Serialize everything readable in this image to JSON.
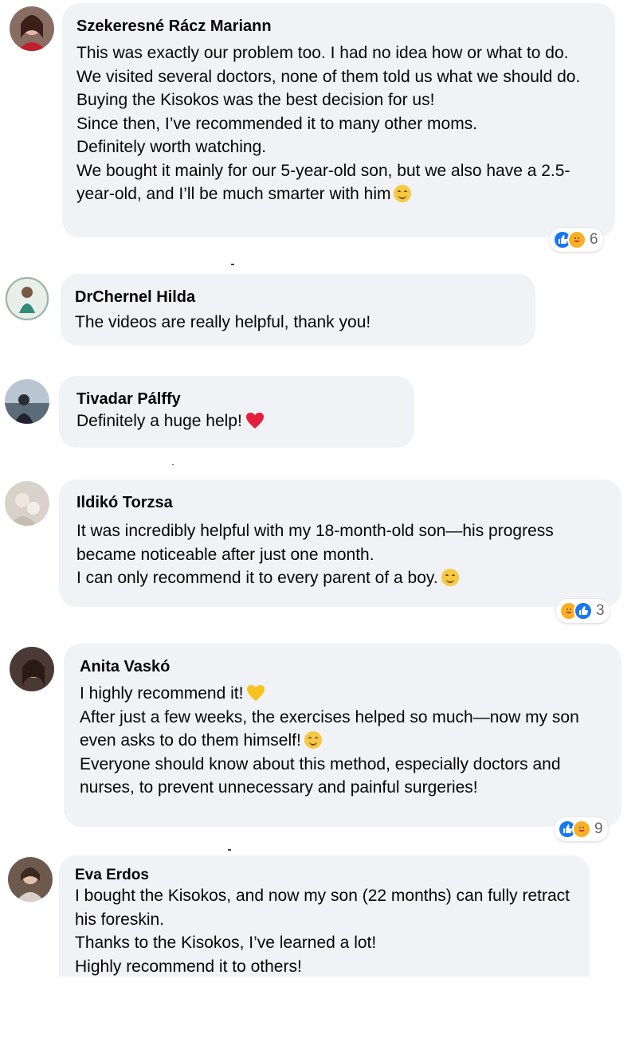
{
  "comments": [
    {
      "name": "Szekeresné Rácz Mariann",
      "lines": [
        "This was exactly our problem too. I had no idea how or what to do.",
        "We visited several doctors, none of them told us what we should do.",
        "Buying the Kisokos was the best decision for us!",
        "Since then, I’ve recommended it to many other moms.",
        "Definitely worth watching.",
        "We bought it mainly for our 5-year-old son, but we also have a 2.5-",
        "year-old, and I’ll be much smarter with him"
      ],
      "reactions": [
        "like",
        "care"
      ],
      "reaction_count": "6"
    },
    {
      "name": "DrChernel Hilda",
      "lines": [
        "The videos are really helpful, thank you!"
      ]
    },
    {
      "name": "Tivadar Pálffy",
      "lines": [
        "Definitely a huge help!"
      ]
    },
    {
      "name": "Ildikó Torzsa",
      "lines": [
        "It was incredibly helpful with my 18-month-old son—his progress",
        "became noticeable after just one month.",
        "I can only recommend it to every parent of a boy."
      ],
      "reactions": [
        "care",
        "like"
      ],
      "reaction_count": "3"
    },
    {
      "name": "Anita Vaskó",
      "lines": [
        "I highly recommend it!",
        "After just a few weeks, the exercises helped so much—now my son",
        "even asks to do them himself!",
        "Everyone should know about this method, especially doctors and",
        "nurses, to prevent unnecessary and painful surgeries!"
      ],
      "reactions": [
        "like",
        "care"
      ],
      "reaction_count": "9"
    },
    {
      "name": "Eva Erdos",
      "lines": [
        "I bought the Kisokos, and now my son (22 months) can fully retract",
        "his foreskin.",
        "Thanks to the Kisokos, I’ve learned a lot!",
        "Highly recommend it to others!"
      ]
    }
  ],
  "colors": {
    "bubble_bg": "#f0f2f5",
    "like_blue": "#1877f2",
    "care_yellow": "#f7b125",
    "heart_red": "#e41e3f",
    "count_gray": "#65676b"
  },
  "icons": {
    "like": "thumbs-up-icon",
    "care": "care-hug-icon",
    "smile": "smiling-face-emoji",
    "red_heart": "red-heart-emoji",
    "yellow_heart": "yellow-heart-emoji"
  }
}
